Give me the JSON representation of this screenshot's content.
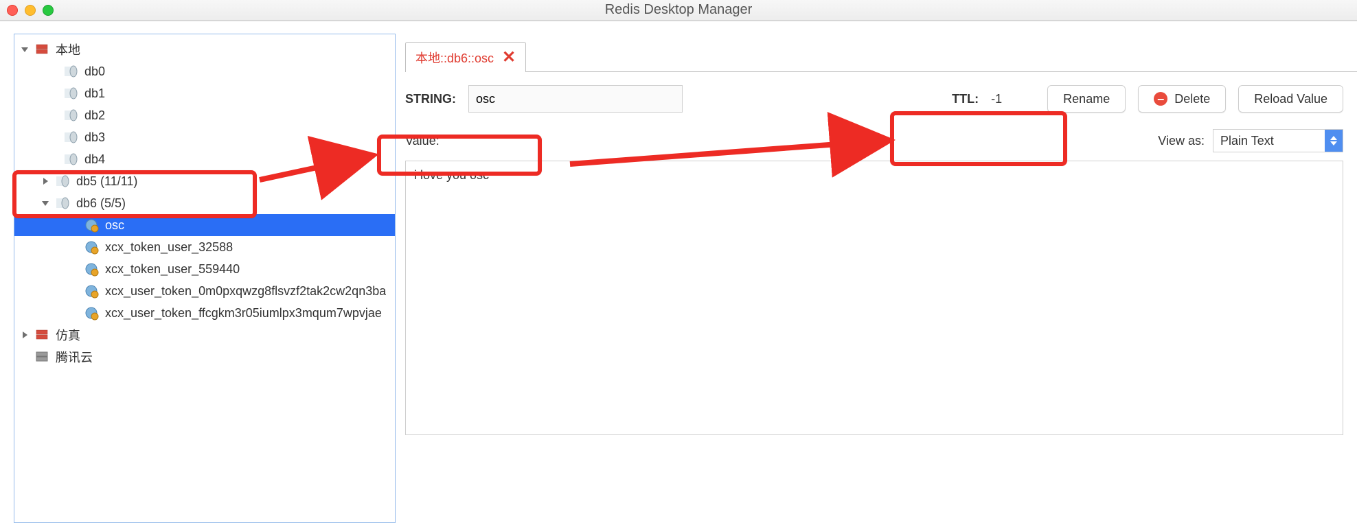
{
  "window": {
    "title": "Redis Desktop Manager"
  },
  "sidebar": {
    "servers": [
      {
        "name": "本地",
        "expanded": true
      },
      {
        "name": "仿真",
        "expanded": false
      },
      {
        "name": "腾讯云",
        "style": "gray"
      }
    ],
    "dbs": [
      {
        "label": "db0"
      },
      {
        "label": "db1"
      },
      {
        "label": "db2"
      },
      {
        "label": "db3"
      },
      {
        "label": "db4"
      },
      {
        "label": "db5 (11/11)",
        "expandable": true
      },
      {
        "label": "db6 (5/5)",
        "expandable": true,
        "expanded": true
      }
    ],
    "keys": [
      {
        "label": "osc",
        "selected": true
      },
      {
        "label": "xcx_token_user_32588"
      },
      {
        "label": "xcx_token_user_559440"
      },
      {
        "label": "xcx_user_token_0m0pxqwzg8flsvzf2tak2cw2qn3ba"
      },
      {
        "label": "xcx_user_token_ffcgkm3r05iumlpx3mqum7wpvjae"
      }
    ]
  },
  "tab": {
    "title": "本地::db6::osc"
  },
  "editor": {
    "type_label": "STRING:",
    "key_name": "osc",
    "ttl_label": "TTL:",
    "ttl_value": "-1",
    "rename": "Rename",
    "delete": "Delete",
    "reload": "Reload Value",
    "value_label": "Value:",
    "viewas_label": "View as:",
    "viewas_selected": "Plain Text",
    "value": "i love you osc"
  }
}
